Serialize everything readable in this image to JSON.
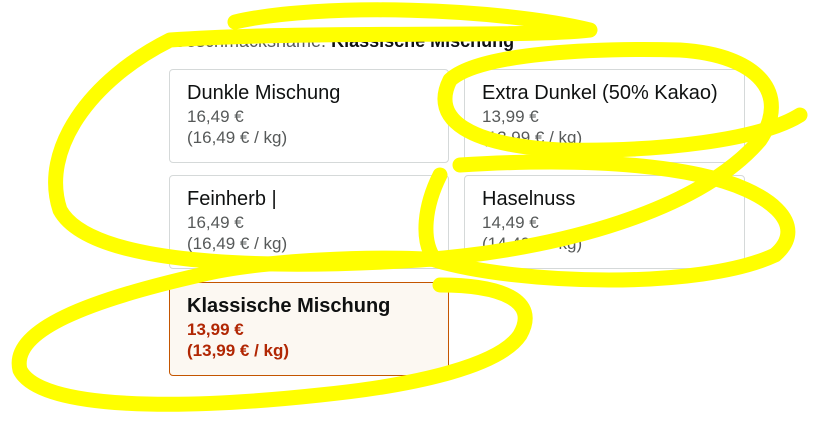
{
  "flavor_selector": {
    "label": "Geschmacksname:",
    "selected_value": "Klassische Mischung",
    "options": [
      {
        "name": "Dunkle Mischung",
        "price": "16,49 €",
        "unit_price": "(16,49 € / kg)",
        "selected": false
      },
      {
        "name": "Extra Dunkel (50% Kakao)",
        "price": "13,99 €",
        "unit_price": "(13,99 € / kg)",
        "selected": false
      },
      {
        "name": "Feinherb |",
        "price": "16,49 €",
        "unit_price": "(16,49 € / kg)",
        "selected": false
      },
      {
        "name": "Haselnuss",
        "price": "14,49 €",
        "unit_price": "(14,49 € / kg)",
        "selected": false
      },
      {
        "name": "Klassische Mischung",
        "price": "13,99 €",
        "unit_price": "(13,99 € / kg)",
        "selected": true
      }
    ]
  },
  "annotation": {
    "color": "#ffff00"
  }
}
